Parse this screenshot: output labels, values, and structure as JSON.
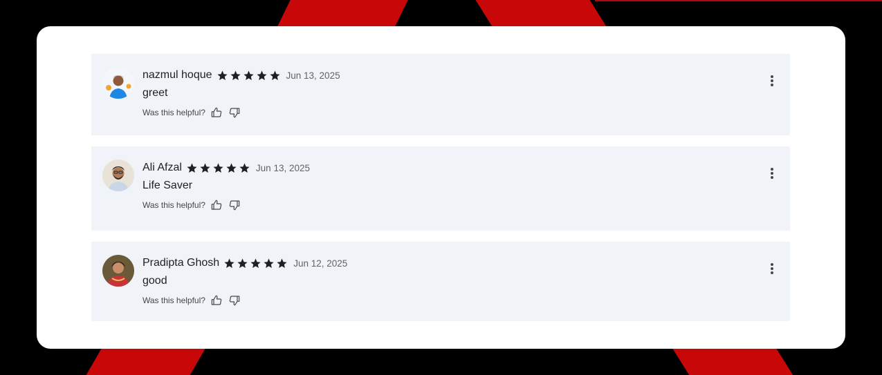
{
  "reviews": [
    {
      "name": "nazmul hoque",
      "rating": 5,
      "date": "Jun 13, 2025",
      "text": "greet",
      "helpful_label": "Was this helpful?"
    },
    {
      "name": "Ali Afzal",
      "rating": 5,
      "date": "Jun 13, 2025",
      "text": "Life Saver",
      "helpful_label": "Was this helpful?"
    },
    {
      "name": "Pradipta Ghosh",
      "rating": 5,
      "date": "Jun 12, 2025",
      "text": "good",
      "helpful_label": "Was this helpful?"
    }
  ],
  "icons": {
    "star": "star-icon",
    "thumb_up": "thumb-up-icon",
    "thumb_down": "thumb-down-icon",
    "more": "more-vert-icon"
  },
  "colors": {
    "background": "#000000",
    "accent_stripe": "#c80808",
    "card": "#ffffff",
    "review_bg": "#f0f3f8",
    "star": "#1f1f1f"
  }
}
